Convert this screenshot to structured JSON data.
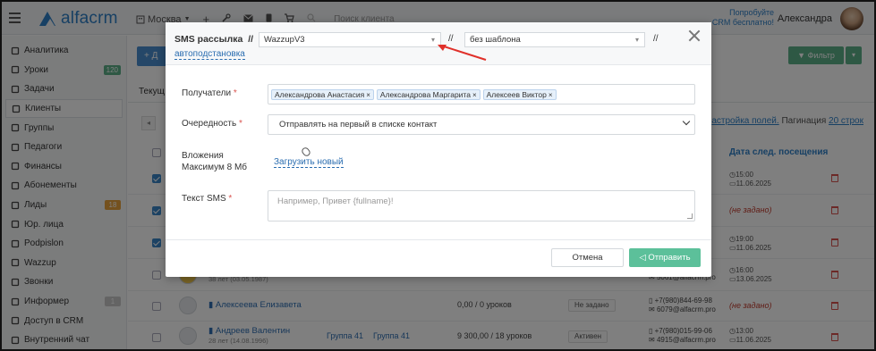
{
  "topbar": {
    "logo": "alfacrm",
    "city": "Москва",
    "search_placeholder": "Поиск клиента",
    "promo_line1": "Попробуйте",
    "promo_line2": "CRM бесплатно!",
    "user_name": "Александра"
  },
  "sidebar": {
    "items": [
      {
        "label": "Аналитика",
        "icon": "chart-icon"
      },
      {
        "label": "Уроки",
        "icon": "calendar-icon",
        "badge": "120",
        "badge_color": "#5cb089"
      },
      {
        "label": "Задачи",
        "icon": "tasks-icon"
      },
      {
        "label": "Клиенты",
        "icon": "user-icon",
        "active": true
      },
      {
        "label": "Группы",
        "icon": "group-icon"
      },
      {
        "label": "Педагоги",
        "icon": "graduation-icon"
      },
      {
        "label": "Финансы",
        "icon": "finance-icon"
      },
      {
        "label": "Абонементы",
        "icon": "tag-icon"
      },
      {
        "label": "Лиды",
        "icon": "lead-icon",
        "badge": "18",
        "badge_color": "#e8a33d"
      },
      {
        "label": "Юр. лица",
        "icon": "building-icon"
      },
      {
        "label": "Podpislon",
        "icon": "document-icon"
      },
      {
        "label": "Wazzup",
        "icon": "chat-icon"
      },
      {
        "label": "Звонки",
        "icon": "phone-icon"
      },
      {
        "label": "Информер",
        "icon": "informer-icon",
        "badge": "1",
        "badge_color": "#c8c8c8"
      },
      {
        "label": "Доступ в CRM",
        "icon": "lock-icon"
      },
      {
        "label": "Внутренний чат",
        "icon": "message-icon"
      }
    ]
  },
  "background": {
    "add_button": "+ Д",
    "filter_button": "Фильтр",
    "tab": "Текущ",
    "settings_link": "астройка полей.",
    "pagination_label": "Пагинация",
    "pagination_link": "20 строк",
    "column_next_visit": "Дата след. посещения",
    "rows": [
      {
        "time": "15:00",
        "date": "11.06.2025"
      },
      {
        "not_set": "(не задано)"
      },
      {
        "time": "19:00",
        "date": "11.06.2025"
      },
      {
        "sub": "38 лет (03.05.1987)",
        "phone": "5061@alfacrm.pro",
        "time": "16:00",
        "date": "13.06.2025"
      },
      {
        "name": "Алексеева Елизавета",
        "amount": "0,00 / 0 уроков",
        "status": "Не задано",
        "phone": "+7(980)844-69-98",
        "email": "6079@alfacrm.pro",
        "not_set": "(не задано)"
      },
      {
        "name": "Андреев Валентин",
        "sub": "28 лет (14.08.1996)",
        "group1": "Группа 41",
        "group2": "Группа 41",
        "amount": "9 300,00 / 18 уроков",
        "status": "Активен",
        "phone": "+7(980)015-99-06",
        "email": "4915@alfacrm.pro",
        "time": "13:00",
        "date": "11.06.2025"
      }
    ]
  },
  "modal": {
    "title": "SMS рассылка",
    "separator": "//",
    "provider": "WazzupV3",
    "template": "без шаблона",
    "autofill_link": "автоподстановка",
    "recipients_label": "Получатели",
    "recipients": [
      "Александрова Анастасия",
      "Александрова Маргарита",
      "Алексеев Виктор"
    ],
    "order_label": "Очередность",
    "order_value": "Отправлять на первый в списке контакт",
    "attachments_label1": "Вложения",
    "attachments_label2": "Максимум 8 Мб",
    "upload_link": "Загрузить новый",
    "sms_text_label": "Текст SMS",
    "sms_placeholder": "Например, Привет {fullname}!",
    "cancel_button": "Отмена",
    "send_button": "Отправить",
    "required_mark": "*",
    "remove_mark": "×"
  },
  "colors": {
    "accent": "#2f80c8",
    "send": "#5cc09a",
    "annotation_arrow": "#e0302a"
  }
}
